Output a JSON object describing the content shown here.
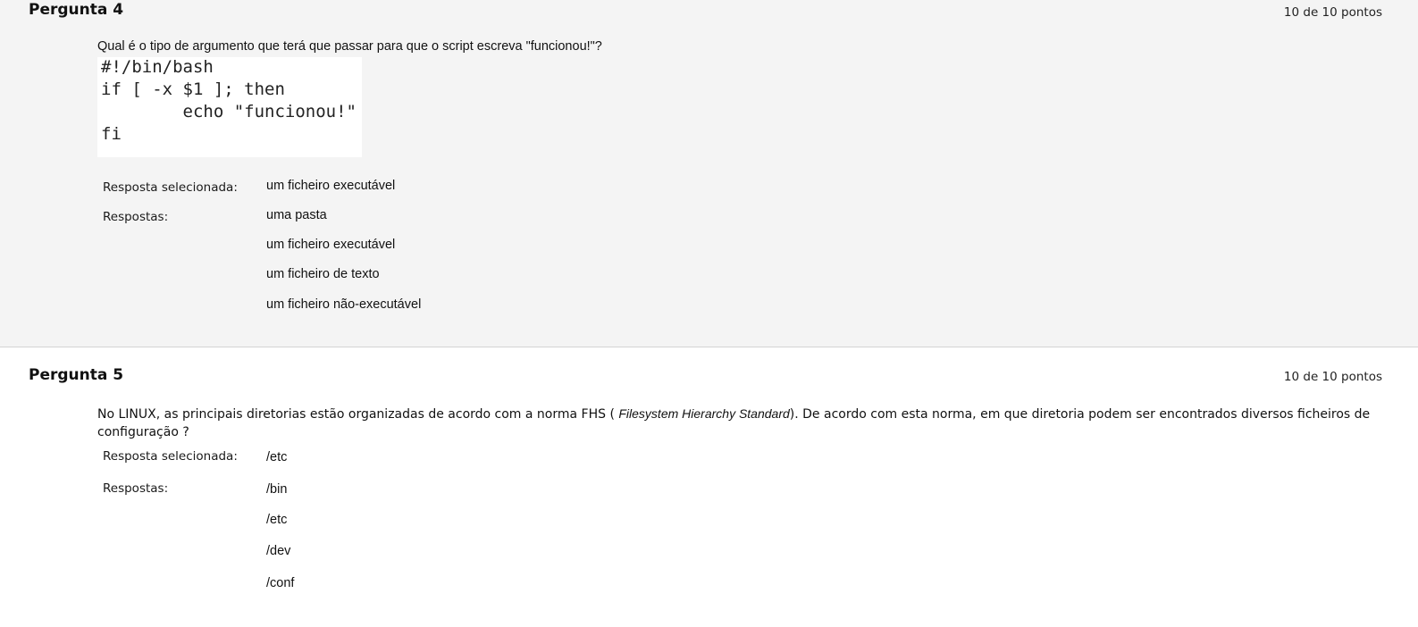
{
  "questions": [
    {
      "title": "Pergunta 4",
      "points": "10 de 10 pontos",
      "text": "Qual é o tipo de argumento que terá que passar para que o script escreva \"funcionou!\"?",
      "code_lines": [
        "#!/bin/bash",
        "if [ -x $1 ]; then",
        "        echo \"funcionou!\"",
        "fi"
      ],
      "selected_label": "Resposta selecionada:",
      "selected_answer": "um ficheiro executável",
      "answers_label": "Respostas:",
      "answers": [
        "uma pasta",
        "um ficheiro executável",
        "um ficheiro de texto",
        "um ficheiro não-executável"
      ]
    },
    {
      "title": "Pergunta 5",
      "points": "10 de 10 pontos",
      "text_before": "No LINUX, as principais diretorias estão organizadas de acordo com a norma FHS ( ",
      "text_italic": "Filesystem Hierarchy Standard",
      "text_after": "). De acordo com esta norma, em que diretoria podem ser encontrados diversos ficheiros de configuração ?",
      "selected_label": "Resposta selecionada:",
      "selected_answer": "/etc",
      "answers_label": "Respostas:",
      "answers": [
        "/bin",
        "/etc",
        "/dev",
        "/conf"
      ]
    }
  ]
}
